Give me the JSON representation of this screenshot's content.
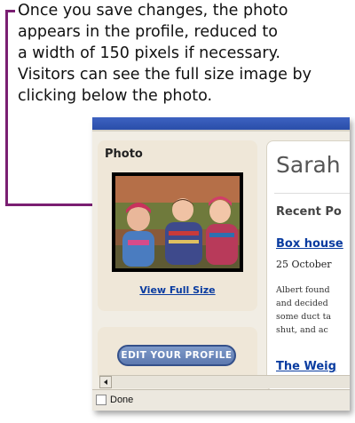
{
  "callout": {
    "lines": [
      "Once you save changes, the photo",
      "appears in the profile, reduced to",
      "a width of 150 pixels if necessary.",
      "Visitors can see the full size image by",
      "clicking below the photo."
    ]
  },
  "photo_panel": {
    "title": "Photo",
    "view_full_size": "View Full Size"
  },
  "edit_panel": {
    "button_label": "EDIT YOUR PROFILE"
  },
  "main": {
    "name": "Sarah",
    "recent_heading": "Recent Po",
    "posts": [
      {
        "title": "Box house",
        "date": "25 October",
        "body_lines": [
          "Albert found",
          "and decided",
          "some duct ta",
          "shut, and ac"
        ]
      },
      {
        "title": "The Weig"
      }
    ]
  },
  "status": {
    "text": "Done"
  },
  "colors": {
    "callout_line": "#7a1f72",
    "link": "#0a3ca0",
    "titlebar": "#2a4ea9",
    "button": "#6a86bb"
  }
}
